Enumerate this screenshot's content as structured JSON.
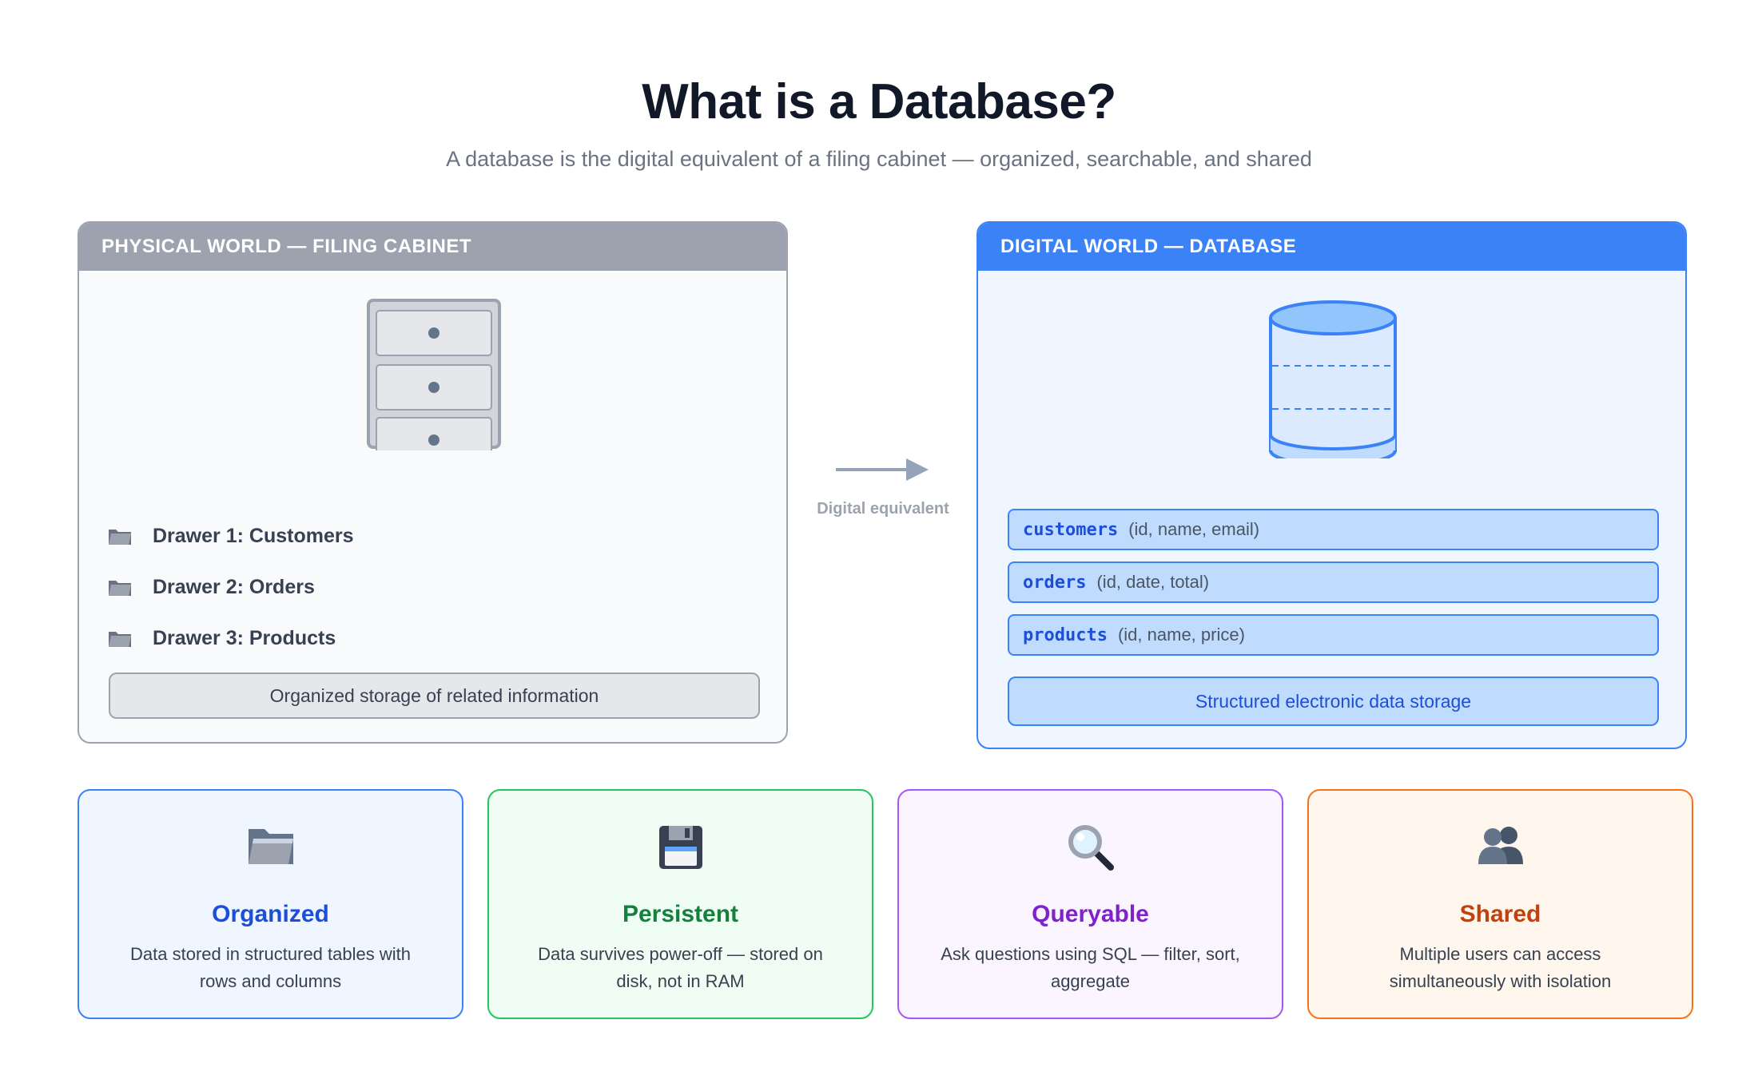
{
  "header": {
    "title": "What is a Database?",
    "subtitle": "A database is the digital equivalent of a filing cabinet — organized, searchable, and shared"
  },
  "physical": {
    "heading": "PHYSICAL WORLD — FILING CABINET",
    "drawers": [
      {
        "label": "Drawer 1: Customers"
      },
      {
        "label": "Drawer 2: Orders"
      },
      {
        "label": "Drawer 3: Products"
      }
    ],
    "summary": "Organized storage of related information"
  },
  "connector": {
    "label": "Digital equivalent"
  },
  "digital": {
    "heading": "DIGITAL WORLD — DATABASE",
    "tables": [
      {
        "name": "customers",
        "columns": "(id, name, email)"
      },
      {
        "name": "orders",
        "columns": "(id, date, total)"
      },
      {
        "name": "products",
        "columns": "(id, name, price)"
      }
    ],
    "summary": "Structured electronic data storage"
  },
  "features": [
    {
      "icon": "folder-icon",
      "title": "Organized",
      "text": "Data stored in structured tables with rows and columns",
      "color": "#1d4ed8",
      "border": "#3b82f6",
      "bg": "#eff6ff"
    },
    {
      "icon": "floppy-disk-icon",
      "title": "Persistent",
      "text": "Data survives power-off — stored on disk, not in RAM",
      "color": "#15803d",
      "border": "#22c55e",
      "bg": "#f0fdf4"
    },
    {
      "icon": "magnifier-icon",
      "title": "Queryable",
      "text": "Ask questions using SQL — filter, sort, aggregate",
      "color": "#7e22ce",
      "border": "#a855f7",
      "bg": "#faf5ff"
    },
    {
      "icon": "users-icon",
      "title": "Shared",
      "text": "Multiple users can access simultaneously with isolation",
      "color": "#c2410c",
      "border": "#f97316",
      "bg": "#fff7ed"
    }
  ]
}
